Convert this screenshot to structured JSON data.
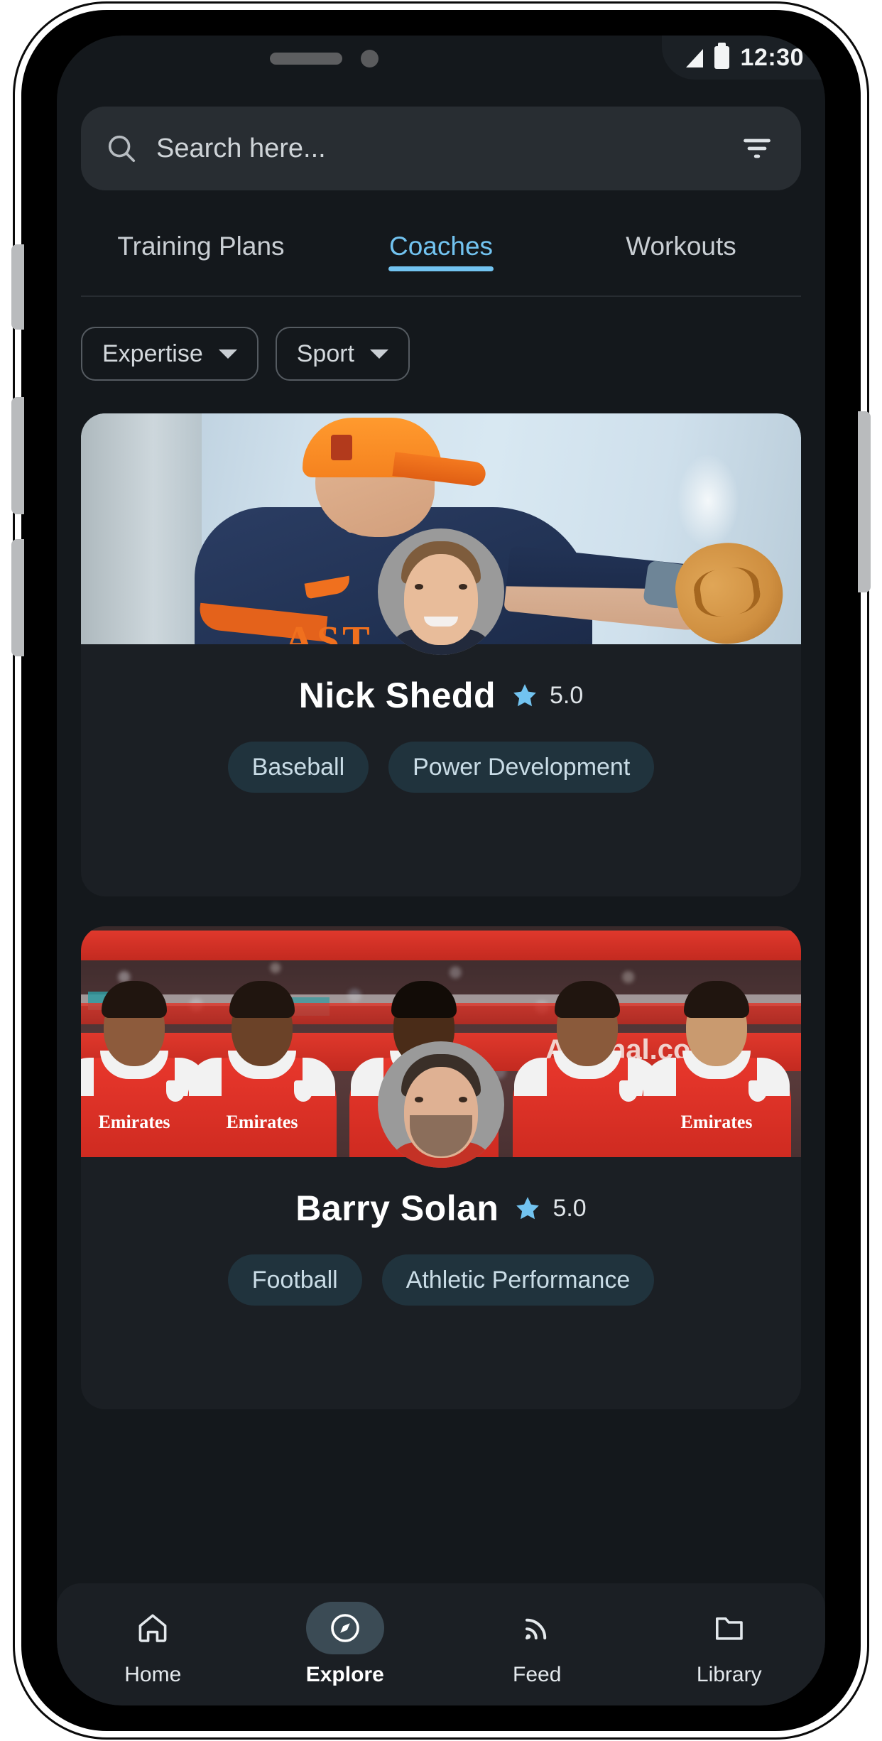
{
  "status_bar": {
    "time": "12:30",
    "signal_icon": "signal-triangle-icon",
    "battery_icon": "battery-full-icon"
  },
  "search": {
    "placeholder": "Search here...",
    "value": "",
    "search_icon": "search-icon",
    "filter_icon": "filter-icon"
  },
  "tabs": [
    {
      "label": "Training Plans",
      "active": false
    },
    {
      "label": "Coaches",
      "active": true
    },
    {
      "label": "Workouts",
      "active": false
    }
  ],
  "filters": [
    {
      "label": "Expertise",
      "icon": "chevron-down-icon"
    },
    {
      "label": "Sport",
      "icon": "chevron-down-icon"
    }
  ],
  "coaches": [
    {
      "name": "Nick Shedd",
      "rating": "5.0",
      "star_icon": "star-icon",
      "tags": [
        "Baseball",
        "Power Development"
      ]
    },
    {
      "name": "Barry Solan",
      "rating": "5.0",
      "star_icon": "star-icon",
      "tags": [
        "Football",
        "Athletic Performance"
      ]
    }
  ],
  "bottom_nav": [
    {
      "label": "Home",
      "icon": "home-icon",
      "active": false
    },
    {
      "label": "Explore",
      "icon": "compass-icon",
      "active": true
    },
    {
      "label": "Feed",
      "icon": "rss-icon",
      "active": false
    },
    {
      "label": "Library",
      "icon": "folder-icon",
      "active": false
    }
  ],
  "colors": {
    "accent": "#72c3f0",
    "screen_bg": "#14181c",
    "card_bg": "#1b1f24",
    "tag_bg": "#20333d",
    "search_bg": "#282d32"
  }
}
